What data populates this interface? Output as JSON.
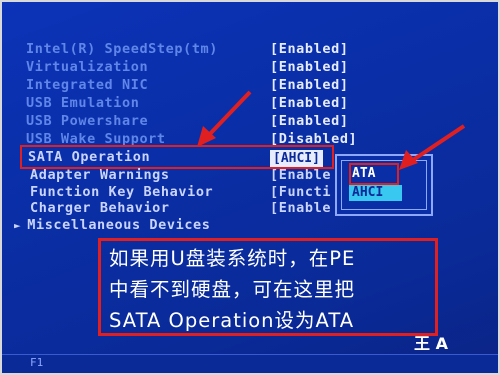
{
  "settings": [
    {
      "label": "Intel(R) SpeedStep(tm)",
      "value": "[Enabled]"
    },
    {
      "label": "Virtualization",
      "value": "[Enabled]"
    },
    {
      "label": "Integrated NIC",
      "value": "[Enabled]"
    },
    {
      "label": "USB Emulation",
      "value": "[Enabled]"
    },
    {
      "label": "USB Powershare",
      "value": "[Enabled]"
    },
    {
      "label": "USB Wake Support",
      "value": "[Disabled]"
    },
    {
      "label": "SATA Operation",
      "value": "[AHCI]"
    },
    {
      "label": "Adapter Warnings",
      "value": "[Enable"
    },
    {
      "label": "Function Key Behavior",
      "value": "[Functi"
    },
    {
      "label": "Charger Behavior",
      "value": "[Enable"
    },
    {
      "label": "Miscellaneous Devices",
      "value": ""
    }
  ],
  "submenu_marker": "►",
  "popup": {
    "options": [
      "ATA",
      "AHCI"
    ],
    "selected": "AHCI",
    "highlighted_annotation": "ATA"
  },
  "annotation": {
    "line1": "如果用U盘装系统时，在PE",
    "line2": "中看不到硬盘，可在这里把",
    "line3": "SATA Operation设为ATA"
  },
  "footer": {
    "hint": "F1",
    "logo": "王 A"
  },
  "colors": {
    "bios_bg": "#0a2a9a",
    "label": "#5f86e8",
    "value": "#e6ecff",
    "annotation_red": "#e02020",
    "selected_option": "#38c8f0"
  }
}
